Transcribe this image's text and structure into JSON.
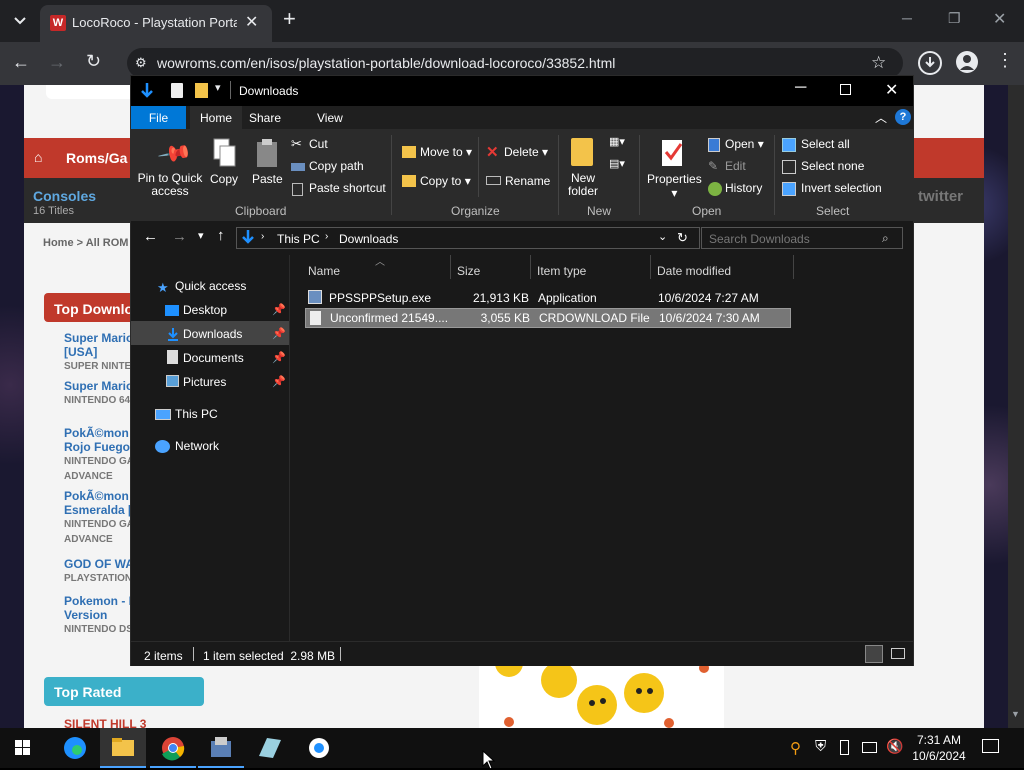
{
  "browser": {
    "tab_title": "LocoRoco - Playstation Portable",
    "url": "wowroms.com/en/isos/playstation-portable/download-locoroco/33852.html",
    "new_tab_label": "+"
  },
  "website": {
    "nav_label": "Roms/Ga",
    "consoles_label": "Consoles",
    "consoles_count": "16 Titles",
    "breadcrumb_home": "Home",
    "breadcrumb_rest": "> All ROM",
    "top_downloads": "Top Downlo",
    "top_rated": "Top Rated",
    "twitter": "twitter",
    "items": [
      {
        "title": "Super Mario\n[USA]",
        "sub": "SUPER NINTEN"
      },
      {
        "title": "Super Mario",
        "sub": "NINTENDO 64"
      },
      {
        "title": "PokÃ©mon\nRojo Fuego",
        "sub": "NINTENDO GA\nADVANCE"
      },
      {
        "title": "PokÃ©mon\nEsmeralda [S",
        "sub": "NINTENDO GA\nADVANCE"
      },
      {
        "title": "GOD OF WA",
        "sub": "PLAYSTATION"
      },
      {
        "title": "Pokemon - F\nVersion",
        "sub": "NINTENDO DS"
      }
    ],
    "last_item": "SILENT HILL 3"
  },
  "explorer": {
    "title": "Downloads",
    "ribbon_tabs": [
      "File",
      "Home",
      "Share",
      "View"
    ],
    "clipboard": {
      "pin": "Pin to Quick\naccess",
      "copy": "Copy",
      "paste": "Paste",
      "cut": "Cut",
      "copy_path": "Copy path",
      "paste_shortcut": "Paste shortcut",
      "group": "Clipboard"
    },
    "organize": {
      "move_to": "Move to",
      "copy_to": "Copy to",
      "delete": "Delete",
      "rename": "Rename",
      "group": "Organize"
    },
    "new": {
      "new_folder": "New\nfolder",
      "group": "New"
    },
    "open": {
      "properties": "Properties",
      "open": "Open",
      "edit": "Edit",
      "history": "History",
      "group": "Open"
    },
    "select": {
      "select_all": "Select all",
      "select_none": "Select none",
      "invert": "Invert selection",
      "group": "Select"
    },
    "address": {
      "this_pc": "This PC",
      "downloads": "Downloads",
      "search_placeholder": "Search Downloads"
    },
    "nav": {
      "quick_access": "Quick access",
      "desktop": "Desktop",
      "downloads": "Downloads",
      "documents": "Documents",
      "pictures": "Pictures",
      "this_pc": "This PC",
      "network": "Network"
    },
    "columns": {
      "name": "Name",
      "size": "Size",
      "type": "Item type",
      "date": "Date modified"
    },
    "files": [
      {
        "name": "PPSSPPSetup.exe",
        "size": "21,913 KB",
        "type": "Application",
        "date": "10/6/2024 7:27 AM"
      },
      {
        "name": "Unconfirmed 21549....",
        "size": "3,055 KB",
        "type": "CRDOWNLOAD File",
        "date": "10/6/2024 7:30 AM"
      }
    ],
    "status": {
      "items": "2 items",
      "selected": "1 item selected  2.98 MB"
    }
  },
  "taskbar": {
    "time": "7:31 AM",
    "date": "10/6/2024"
  },
  "colors": {
    "accent": "#0078d7",
    "ribbon_bg": "#2b2b2b",
    "selected_row": "#777777",
    "red": "#c0392b"
  }
}
